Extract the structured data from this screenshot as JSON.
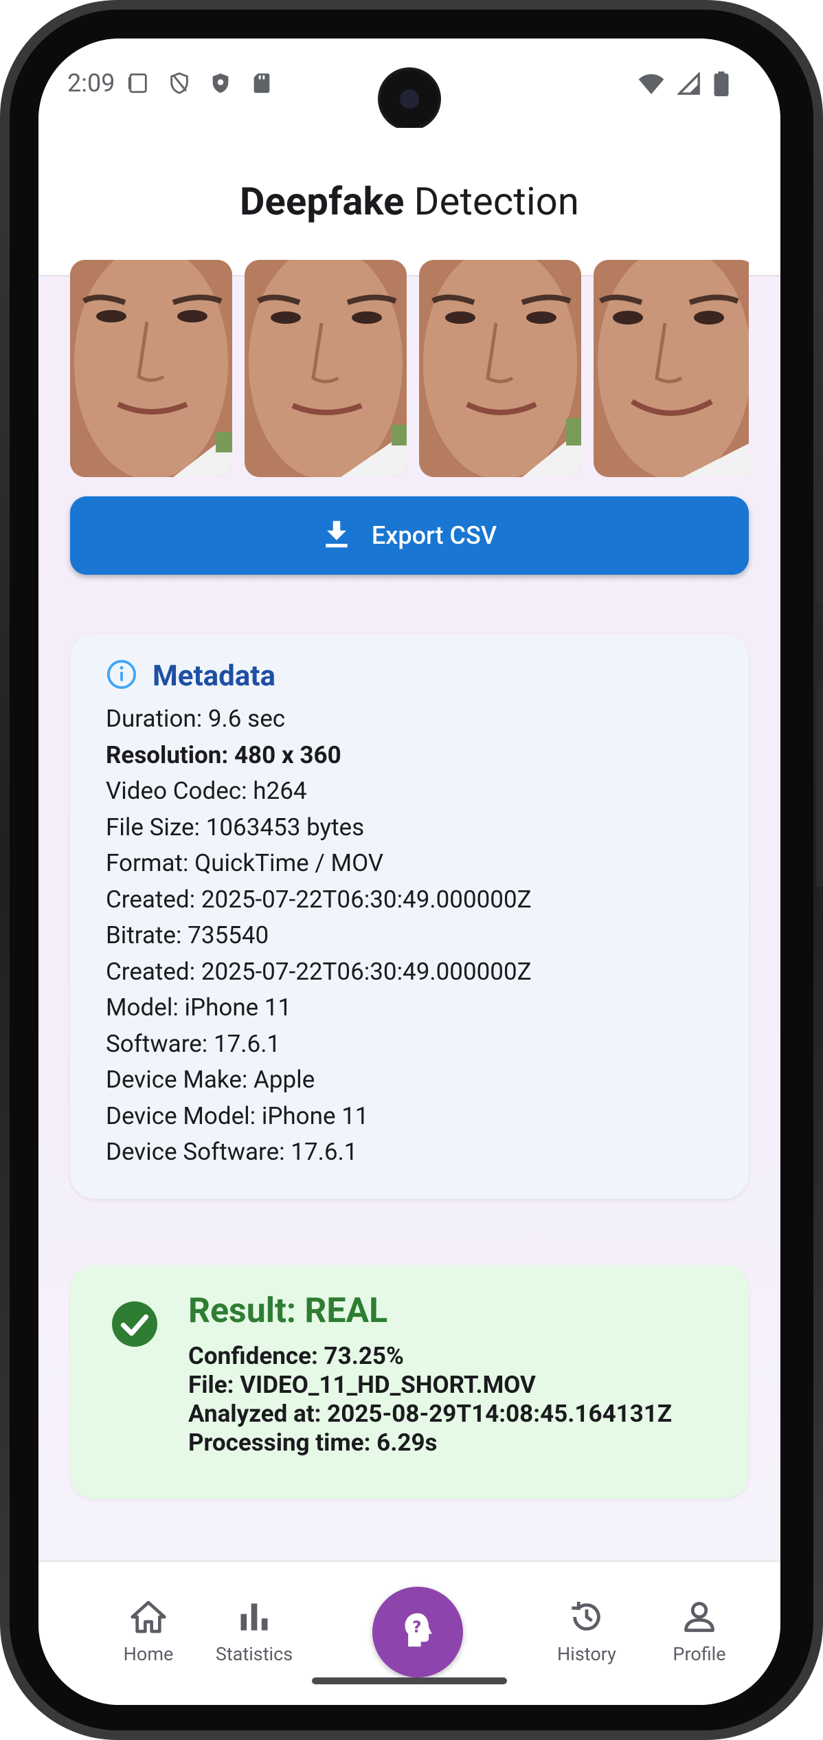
{
  "status_bar": {
    "time": "2:09"
  },
  "app_bar": {
    "title_bold": "Deepfake",
    "title_regular": "Detection"
  },
  "frames": [
    "frame-1",
    "frame-2",
    "frame-3",
    "frame-4"
  ],
  "export": {
    "label": "Export CSV"
  },
  "metadata": {
    "title": "Metadata",
    "lines": [
      "Duration: 9.6 sec",
      "Resolution: 480 x 360",
      "Video Codec: h264",
      "File Size: 1063453 bytes",
      "Format: QuickTime / MOV",
      "Created: 2025-07-22T06:30:49.000000Z",
      "Bitrate: 735540",
      "Created: 2025-07-22T06:30:49.000000Z",
      "Model: iPhone 11",
      "Software: 17.6.1",
      "Device Make: Apple",
      "Device Model: iPhone 11",
      "Device Software: 17.6.1"
    ]
  },
  "result": {
    "title": "Result: REAL",
    "confidence": "Confidence: 73.25%",
    "file": "File: VIDEO_11_HD_SHORT.MOV",
    "analyzed_at": "Analyzed at: 2025-08-29T14:08:45.164131Z",
    "processing_time": "Processing time: 6.29s"
  },
  "nav": {
    "home": "Home",
    "statistics": "Statistics",
    "history": "History",
    "profile": "Profile"
  },
  "colors": {
    "primary_button": "#1976d2",
    "metadata_title": "#1e4fa3",
    "result_green": "#2e7d32",
    "fab_purple": "#8e44ad"
  }
}
